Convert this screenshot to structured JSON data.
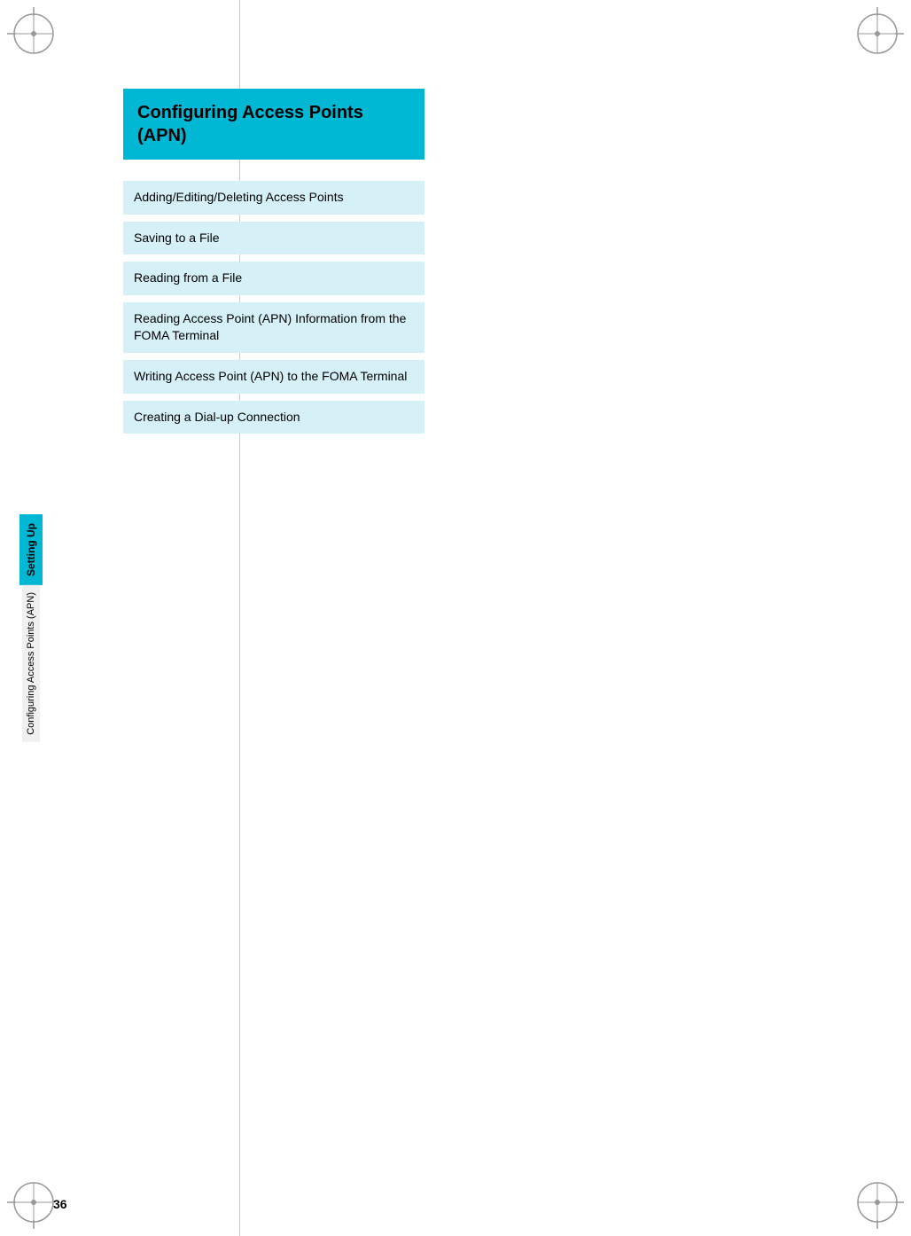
{
  "page": {
    "number": "36",
    "background": "#ffffff"
  },
  "title_box": {
    "text": "Configuring Access Points (APN)",
    "background_color": "#00b7d4"
  },
  "menu_items": [
    {
      "id": "item-1",
      "label": "Adding/Editing/Deleting Access Points"
    },
    {
      "id": "item-2",
      "label": "Saving to a File"
    },
    {
      "id": "item-3",
      "label": "Reading from a File"
    },
    {
      "id": "item-4",
      "label": "Reading Access Point (APN) Information from the FOMA Terminal"
    },
    {
      "id": "item-5",
      "label": "Writing Access Point (APN) to the FOMA Terminal"
    },
    {
      "id": "item-6",
      "label": "Creating a Dial-up Connection"
    }
  ],
  "side_labels": {
    "tab_label": "Setting Up",
    "section_label": "Configuring Access Points (APN)"
  }
}
